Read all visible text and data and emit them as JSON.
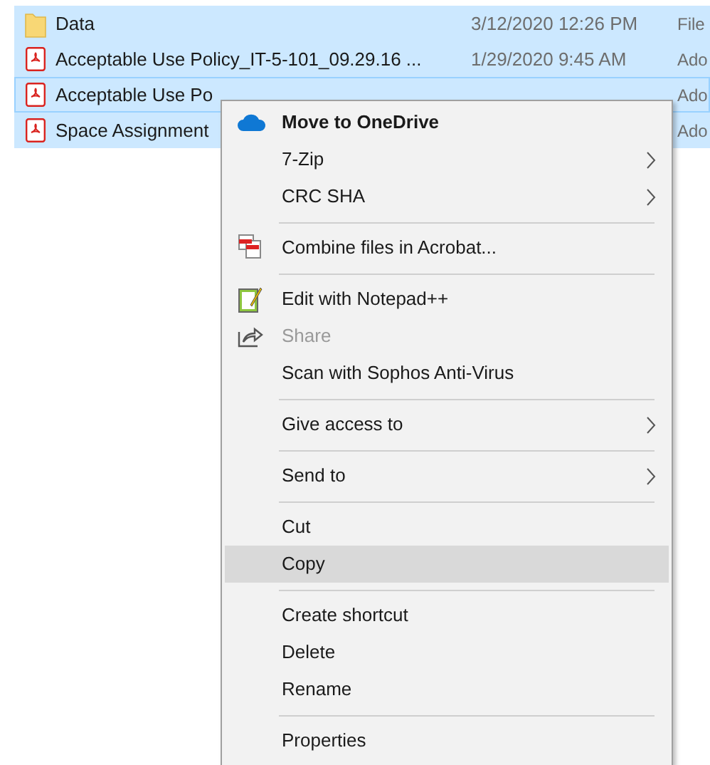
{
  "files": [
    {
      "kind": "folder",
      "name": "Data",
      "modified": "3/12/2020 12:26 PM",
      "type": "File",
      "selected": true,
      "focused": false
    },
    {
      "kind": "pdf",
      "name": "Acceptable Use Policy_IT-5-101_09.29.16 ...",
      "modified": "1/29/2020 9:45 AM",
      "type": "Ado",
      "selected": true,
      "focused": false
    },
    {
      "kind": "pdf",
      "name": "Acceptable Use Po",
      "type": "Ado",
      "selected": true,
      "focused": true
    },
    {
      "kind": "pdf",
      "name": "Space Assignment",
      "type": "Ado",
      "selected": true,
      "focused": false
    }
  ],
  "context_menu": [
    {
      "kind": "item",
      "label": "Move to OneDrive",
      "default": true,
      "disabled": false,
      "submenu": false,
      "selected": false
    },
    {
      "kind": "item",
      "label": "7-Zip",
      "default": false,
      "disabled": false,
      "submenu": true,
      "selected": false
    },
    {
      "kind": "item",
      "label": "CRC SHA",
      "default": false,
      "disabled": false,
      "submenu": true,
      "selected": false
    },
    {
      "kind": "separator"
    },
    {
      "kind": "item",
      "label": "Combine files in Acrobat...",
      "default": false,
      "disabled": false,
      "submenu": false,
      "selected": false
    },
    {
      "kind": "separator"
    },
    {
      "kind": "item",
      "label": "Edit with Notepad++",
      "default": false,
      "disabled": false,
      "submenu": false,
      "selected": false
    },
    {
      "kind": "item",
      "label": "Share",
      "default": false,
      "disabled": true,
      "submenu": false,
      "selected": false
    },
    {
      "kind": "item",
      "label": "Scan with Sophos Anti-Virus",
      "default": false,
      "disabled": false,
      "submenu": false,
      "selected": false
    },
    {
      "kind": "separator"
    },
    {
      "kind": "item",
      "label": "Give access to",
      "default": false,
      "disabled": false,
      "submenu": true,
      "selected": false
    },
    {
      "kind": "separator"
    },
    {
      "kind": "item",
      "label": "Send to",
      "default": false,
      "disabled": false,
      "submenu": true,
      "selected": false
    },
    {
      "kind": "separator"
    },
    {
      "kind": "item",
      "label": "Cut",
      "default": false,
      "disabled": false,
      "submenu": false,
      "selected": false
    },
    {
      "kind": "item",
      "label": "Copy",
      "default": false,
      "disabled": false,
      "submenu": false,
      "selected": true
    },
    {
      "kind": "separator"
    },
    {
      "kind": "item",
      "label": "Create shortcut",
      "default": false,
      "disabled": false,
      "submenu": false,
      "selected": false
    },
    {
      "kind": "item",
      "label": "Delete",
      "default": false,
      "disabled": false,
      "submenu": false,
      "selected": false
    },
    {
      "kind": "item",
      "label": "Rename",
      "default": false,
      "disabled": false,
      "submenu": false,
      "selected": false
    },
    {
      "kind": "separator"
    },
    {
      "kind": "item",
      "label": "Properties",
      "default": false,
      "disabled": false,
      "submenu": false,
      "selected": false
    }
  ]
}
